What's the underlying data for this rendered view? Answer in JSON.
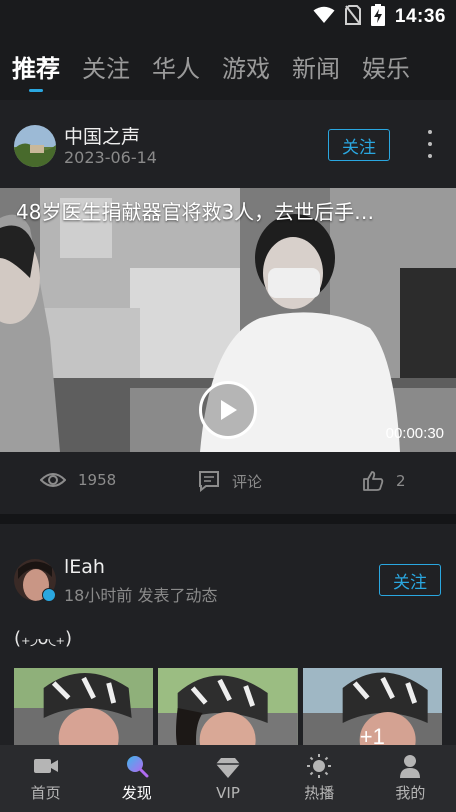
{
  "status_bar": {
    "time": "14:36"
  },
  "tabs": [
    {
      "label": "推荐",
      "active": true
    },
    {
      "label": "关注"
    },
    {
      "label": "华人"
    },
    {
      "label": "游戏"
    },
    {
      "label": "新闻"
    },
    {
      "label": "娱乐"
    }
  ],
  "post1": {
    "author": "中国之声",
    "date": "2023-06-14",
    "follow_label": "关注",
    "video_title": "48岁医生捐献器官将救3人，去世后手…",
    "duration": "00:00:30",
    "views": "1958",
    "comment_label": "评论",
    "likes": "2"
  },
  "post2": {
    "author": "lEah",
    "meta": "18小时前  发表了动态",
    "follow_label": "关注",
    "text": "(₊◞ᴗ◟₊)",
    "more_count": "+1"
  },
  "bottom_nav": [
    {
      "label": "首页",
      "icon": "video-camera-icon"
    },
    {
      "label": "发现",
      "icon": "discover-search-icon",
      "active": true
    },
    {
      "label": "VIP",
      "icon": "diamond-icon"
    },
    {
      "label": "热播",
      "icon": "sun-icon"
    },
    {
      "label": "我的",
      "icon": "user-icon"
    }
  ],
  "colors": {
    "accent": "#2aa7e0",
    "background": "#1a1b1d",
    "card": "#202124"
  }
}
